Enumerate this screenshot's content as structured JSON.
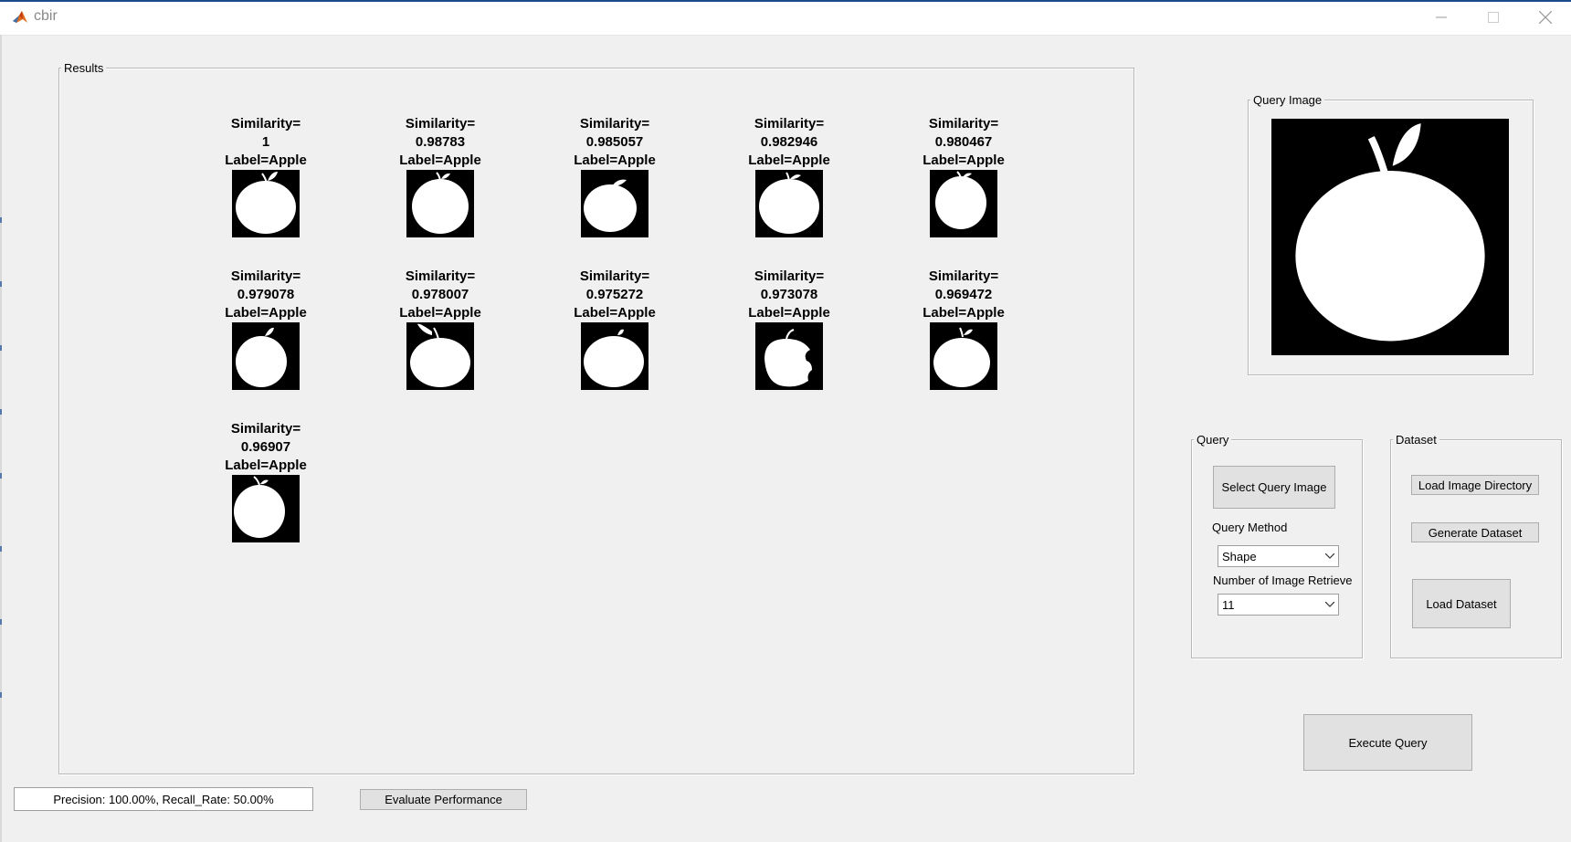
{
  "window": {
    "title": "cbir"
  },
  "results": {
    "group_label": "Results",
    "items": [
      {
        "line1": "Similarity=",
        "line2": "1",
        "line3": "Label=Apple"
      },
      {
        "line1": "Similarity=",
        "line2": "0.98783",
        "line3": "Label=Apple"
      },
      {
        "line1": "Similarity=",
        "line2": "0.985057",
        "line3": "Label=Apple"
      },
      {
        "line1": "Similarity=",
        "line2": "0.982946",
        "line3": "Label=Apple"
      },
      {
        "line1": "Similarity=",
        "line2": "0.980467",
        "line3": "Label=Apple"
      },
      {
        "line1": "Similarity=",
        "line2": "0.979078",
        "line3": "Label=Apple"
      },
      {
        "line1": "Similarity=",
        "line2": "0.978007",
        "line3": "Label=Apple"
      },
      {
        "line1": "Similarity=",
        "line2": "0.975272",
        "line3": "Label=Apple"
      },
      {
        "line1": "Similarity=",
        "line2": "0.973078",
        "line3": "Label=Apple"
      },
      {
        "line1": "Similarity=",
        "line2": "0.969472",
        "line3": "Label=Apple"
      },
      {
        "line1": "Similarity=",
        "line2": "0.96907",
        "line3": "Label=Apple"
      }
    ]
  },
  "query_image": {
    "group_label": "Query Image"
  },
  "query": {
    "group_label": "Query",
    "select_button": "Select Query Image",
    "method_label": "Query Method",
    "method_value": "Shape",
    "count_label": "Number of Image Retrieve",
    "count_value": "11"
  },
  "dataset": {
    "group_label": "Dataset",
    "load_dir_button": "Load Image Directory",
    "generate_button": "Generate Dataset",
    "load_dataset_button": "Load Dataset"
  },
  "execute_button": "Execute Query",
  "status": "Precision: 100.00%, Recall_Rate: 50.00%",
  "evaluate_button": "Evaluate Performance",
  "colors": {
    "accent": "#1a4a8a",
    "button_bg": "#e1e1e1",
    "window_bg": "#f0f0f0"
  }
}
